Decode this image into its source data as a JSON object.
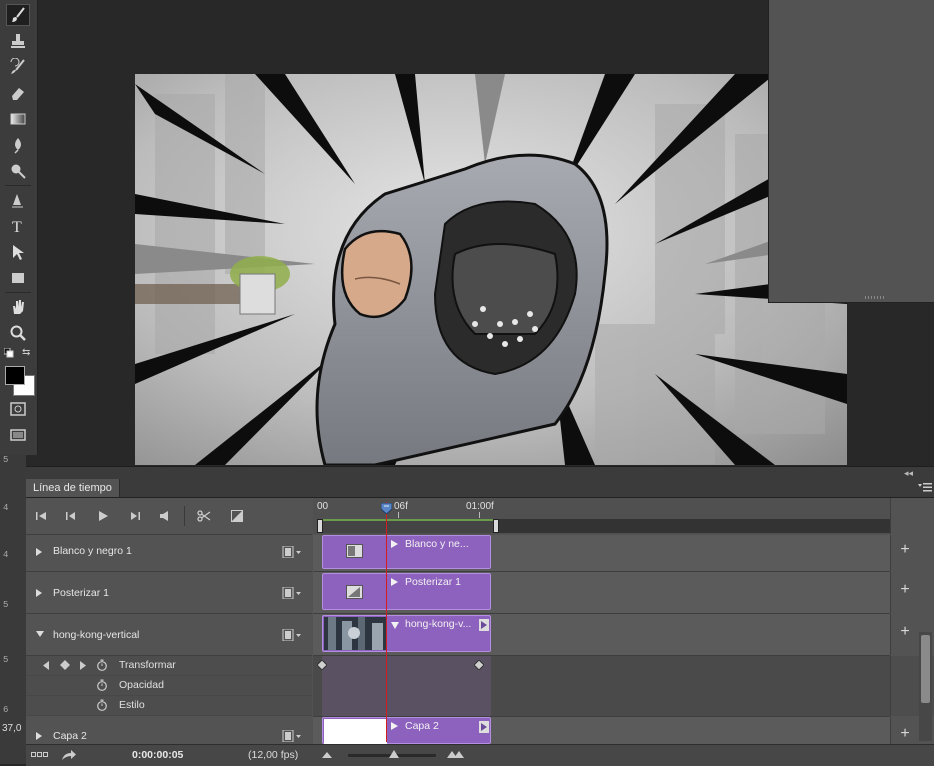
{
  "toolbar": {
    "tools": [
      "brush-icon",
      "clone-stamp-icon",
      "history-brush-icon",
      "eraser-icon",
      "gradient-icon",
      "blur-icon",
      "dodge-icon",
      "pen-icon",
      "type-icon",
      "path-selection-icon",
      "rectangle-icon",
      "hand-icon",
      "zoom-icon"
    ],
    "foreground_color": "#000000",
    "background_color": "#ffffff"
  },
  "ruler": {
    "numbers": [
      "5",
      "4",
      "4",
      "5",
      "5",
      "5",
      "6"
    ],
    "zoom": "37,0"
  },
  "timeline": {
    "tab_label": "Línea de tiempo",
    "ruler_labels": [
      "00",
      "06f",
      "01:00f"
    ],
    "layers": [
      {
        "name": "Blanco y negro 1",
        "clip_label": "Blanco y ne...",
        "expanded": false
      },
      {
        "name": "Posterizar 1",
        "clip_label": "Posterizar 1",
        "expanded": false
      },
      {
        "name": "hong-kong-vertical",
        "clip_label": "hong-kong-v...",
        "expanded": true,
        "properties": [
          "Transformar",
          "Opacidad",
          "Estilo"
        ]
      },
      {
        "name": "Capa 2",
        "clip_label": "Capa 2",
        "expanded": false
      }
    ],
    "current_time": "0:00:00:05",
    "fps": "(12,00 fps)",
    "playhead_frame": 5
  },
  "colors": {
    "clip": "#8d61be",
    "playhead": "#d21e1e",
    "work_area": "#6a9b4c"
  }
}
